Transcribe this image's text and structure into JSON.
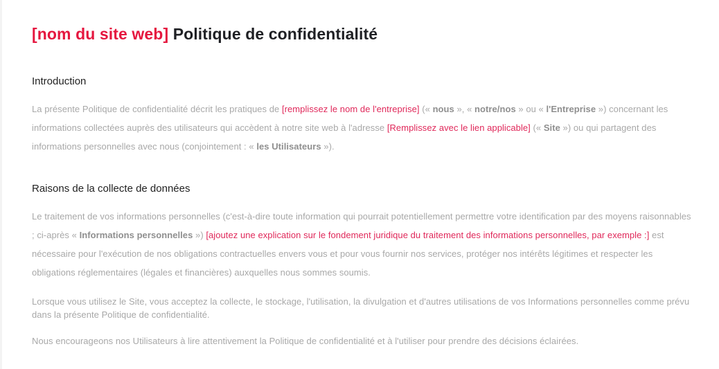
{
  "colors": {
    "accent": "#e5173f",
    "placeholder_text": "#e0285a",
    "body_text": "#a8a8a8",
    "heading_text": "#222222"
  },
  "title": {
    "placeholder": "[nom du site web]",
    "text": "Politique de confidentialité"
  },
  "sections": [
    {
      "heading": "Introduction",
      "paragraphs": [
        {
          "s1": "La présente Politique de confidentialité décrit les pratiques de ",
          "ph1": "[remplissez le nom de l'entreprise]",
          "s2": " (« ",
          "b1": "nous",
          "s3": " », « ",
          "b2": "notre/nos",
          "s4": " » ou « ",
          "b3": "l'Entreprise",
          "s5": " ») concernant les informations collectées auprès des utilisateurs qui accèdent à notre site web à l'adresse ",
          "ph2": "[Remplissez avec le lien applicable]",
          "s6": " (« ",
          "b4": "Site",
          "s7": " ») ou qui partagent des informations personnelles avec nous (conjointement : « ",
          "b5": "les Utilisateurs",
          "s8": " »)."
        }
      ]
    },
    {
      "heading": "Raisons de la collecte de données",
      "paragraphs": [
        {
          "s1": "Le traitement de vos informations personnelles (c'est-à-dire toute information qui pourrait potentiellement permettre votre identification par des moyens raisonnables ; ci-après « ",
          "b1": "Informations personnelles",
          "s2": " ») ",
          "ph1": "[ajoutez une explication sur le fondement juridique du traitement des informations personnelles, par exemple :]",
          "s3": " est nécessaire pour l'exécution de nos obligations contractuelles envers vous et pour vous fournir nos services, protéger nos intérêts légitimes et respecter les obligations réglementaires (légales et financières) auxquelles nous sommes soumis."
        },
        {
          "text": "Lorsque vous utilisez le Site, vous acceptez la collecte, le stockage, l'utilisation, la divulgation et d'autres utilisations de vos Informations personnelles comme prévu dans la présente Politique de confidentialité."
        },
        {
          "text": "Nous encourageons nos Utilisateurs à lire attentivement la Politique de confidentialité et à l'utiliser pour prendre des décisions éclairées."
        }
      ]
    }
  ]
}
